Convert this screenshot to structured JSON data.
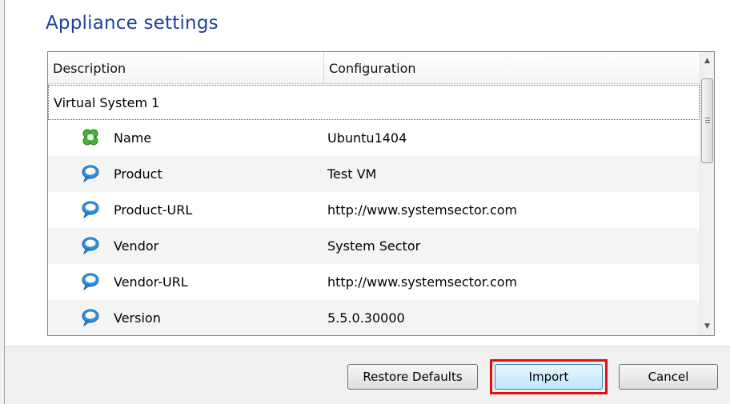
{
  "section_title": "Appliance settings",
  "table": {
    "headers": {
      "description": "Description",
      "configuration": "Configuration"
    },
    "group": {
      "label": "Virtual System 1"
    },
    "rows": [
      {
        "icon": "name-puzzle-icon",
        "description": "Name",
        "configuration": "Ubuntu1404"
      },
      {
        "icon": "speech-bubble-icon",
        "description": "Product",
        "configuration": "Test VM"
      },
      {
        "icon": "speech-bubble-icon",
        "description": "Product-URL",
        "configuration": "http://www.systemsector.com"
      },
      {
        "icon": "speech-bubble-icon",
        "description": "Vendor",
        "configuration": "System Sector"
      },
      {
        "icon": "speech-bubble-icon",
        "description": "Vendor-URL",
        "configuration": "http://www.systemsector.com"
      },
      {
        "icon": "speech-bubble-icon",
        "description": "Version",
        "configuration": "5.5.0.30000"
      }
    ]
  },
  "buttons": {
    "restore_defaults": "Restore Defaults",
    "import": "Import",
    "cancel": "Cancel"
  },
  "colors": {
    "title": "#1f3fa0",
    "highlight": "#e01010",
    "name_icon": "#4caf3c",
    "bubble_icon": "#2f8fe0"
  }
}
